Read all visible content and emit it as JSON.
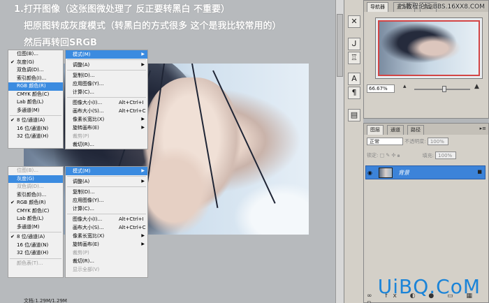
{
  "steps": [
    "1.打开图像（这张图微处理了 反正要转黑白 不重要）",
    "把原图转成灰度模式（转黑白的方式很多 这个是我比较常用的）",
    "然后再转回SRGB"
  ],
  "menu_top": {
    "items": [
      {
        "label": "位图(B)...",
        "state": "normal",
        "checked": false
      },
      {
        "label": "灰度(G)",
        "state": "normal",
        "checked": true
      },
      {
        "label": "双色调(D)...",
        "state": "normal",
        "checked": false
      },
      {
        "label": "索引颜色(I)...",
        "state": "normal",
        "checked": false
      },
      {
        "label": "RGB 颜色(R)",
        "state": "highlight",
        "checked": false
      },
      {
        "label": "CMYK 颜色(C)",
        "state": "normal",
        "checked": false
      },
      {
        "label": "Lab 颜色(L)",
        "state": "normal",
        "checked": false
      },
      {
        "label": "多通道(M)",
        "state": "normal",
        "checked": false
      },
      {
        "sep": true
      },
      {
        "label": "8 位/通道(A)",
        "state": "normal",
        "checked": true
      },
      {
        "label": "16 位/通道(N)",
        "state": "normal",
        "checked": false
      },
      {
        "label": "32 位/通道(H)",
        "state": "normal",
        "checked": false
      }
    ]
  },
  "menu_bottom": {
    "items": [
      {
        "label": "位图(B)...",
        "state": "disabled",
        "checked": false
      },
      {
        "label": "灰度(G)",
        "state": "highlight",
        "checked": false
      },
      {
        "label": "双色调(D)...",
        "state": "disabled",
        "checked": false
      },
      {
        "label": "索引颜色(I)...",
        "state": "normal",
        "checked": false
      },
      {
        "label": "RGB 颜色(R)",
        "state": "normal",
        "checked": true
      },
      {
        "label": "CMYK 颜色(C)",
        "state": "normal",
        "checked": false
      },
      {
        "label": "Lab 颜色(L)",
        "state": "normal",
        "checked": false
      },
      {
        "label": "多通道(M)",
        "state": "normal",
        "checked": false
      },
      {
        "sep": true
      },
      {
        "label": "8 位/通道(A)",
        "state": "normal",
        "checked": true
      },
      {
        "label": "16 位/通道(N)",
        "state": "normal",
        "checked": false
      },
      {
        "label": "32 位/通道(H)",
        "state": "normal",
        "checked": false
      },
      {
        "sep": true
      },
      {
        "label": "颜色表(T)...",
        "state": "disabled",
        "checked": false
      }
    ]
  },
  "submenu_top": {
    "items": [
      {
        "label": "模式(M)",
        "state": "highlight",
        "arrow": true,
        "shortcut": ""
      },
      {
        "sep": true
      },
      {
        "label": "调整(A)",
        "state": "normal",
        "arrow": true,
        "shortcut": ""
      },
      {
        "sep": true
      },
      {
        "label": "复制(D)...",
        "state": "normal",
        "arrow": false,
        "shortcut": ""
      },
      {
        "label": "应用图像(Y)...",
        "state": "normal",
        "arrow": false,
        "shortcut": ""
      },
      {
        "label": "计算(C)...",
        "state": "normal",
        "arrow": false,
        "shortcut": ""
      },
      {
        "sep": true
      },
      {
        "label": "图像大小(I)...",
        "state": "normal",
        "arrow": false,
        "shortcut": "Alt+Ctrl+I"
      },
      {
        "label": "画布大小(S)...",
        "state": "normal",
        "arrow": false,
        "shortcut": "Alt+Ctrl+C"
      },
      {
        "label": "像素长宽比(X)",
        "state": "normal",
        "arrow": true,
        "shortcut": ""
      },
      {
        "label": "旋转画布(E)",
        "state": "normal",
        "arrow": true,
        "shortcut": ""
      },
      {
        "label": "裁剪(P)",
        "state": "disabled",
        "arrow": false,
        "shortcut": ""
      },
      {
        "label": "裁切(R)...",
        "state": "normal",
        "arrow": false,
        "shortcut": ""
      }
    ]
  },
  "submenu_bottom": {
    "items": [
      {
        "label": "模式(M)",
        "state": "highlight",
        "arrow": true,
        "shortcut": ""
      },
      {
        "sep": true
      },
      {
        "label": "调整(A)",
        "state": "normal",
        "arrow": true,
        "shortcut": ""
      },
      {
        "sep": true
      },
      {
        "label": "复制(D)...",
        "state": "normal",
        "arrow": false,
        "shortcut": ""
      },
      {
        "label": "应用图像(Y)...",
        "state": "normal",
        "arrow": false,
        "shortcut": ""
      },
      {
        "label": "计算(C)...",
        "state": "normal",
        "arrow": false,
        "shortcut": ""
      },
      {
        "sep": true
      },
      {
        "label": "图像大小(I)...",
        "state": "normal",
        "arrow": false,
        "shortcut": "Alt+Ctrl+I"
      },
      {
        "label": "画布大小(S)...",
        "state": "normal",
        "arrow": false,
        "shortcut": "Alt+Ctrl+C"
      },
      {
        "label": "像素长宽比(X)",
        "state": "normal",
        "arrow": true,
        "shortcut": ""
      },
      {
        "label": "旋转画布(E)",
        "state": "normal",
        "arrow": true,
        "shortcut": ""
      },
      {
        "label": "裁剪(P)",
        "state": "disabled",
        "arrow": false,
        "shortcut": ""
      },
      {
        "label": "裁切(R)...",
        "state": "normal",
        "arrow": false,
        "shortcut": ""
      },
      {
        "label": "显示全部(V)",
        "state": "disabled",
        "arrow": false,
        "shortcut": ""
      }
    ]
  },
  "status": {
    "doc_info": "文档:1.29M/1.29M"
  },
  "navigator": {
    "tabs": [
      "导航器",
      "直方图",
      "信息"
    ],
    "zoom": "66.67%"
  },
  "layers": {
    "tabs": [
      "图层",
      "通道",
      "路径"
    ],
    "blend_mode": "正常",
    "opacity_label": "不透明度:",
    "opacity_value": "100%",
    "lock_label": "锁定:",
    "fill_label": "填充:",
    "fill_value": "100%",
    "layer_name": "背景"
  },
  "watermarks": {
    "top": "PS教程论坛 BBS.16XX8.COM",
    "bottom": "UiBQ.CoM"
  },
  "colors": {
    "highlight": "#3b8be0",
    "layer_selected": "#3c83d9",
    "watermark_blue": "#1b84d8",
    "nav_frame": "#d34545"
  }
}
